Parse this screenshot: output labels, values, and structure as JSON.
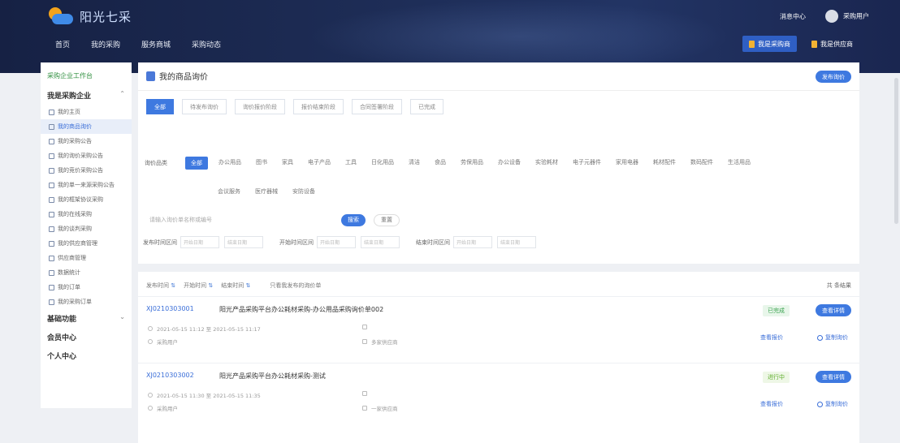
{
  "header": {
    "brand": "阳光七采",
    "nav": [
      "首页",
      "我的采购",
      "服务商城",
      "采购动态"
    ],
    "right": {
      "message": "消息中心",
      "user": "采购用户"
    },
    "buttons": [
      "我是采购商",
      "我是供应商"
    ]
  },
  "sidebar": {
    "workbench": "采购企业工作台",
    "group1": "我是采购企业",
    "items": [
      "我的主页",
      "我的商品询价",
      "我的采购公告",
      "我的询价采购公告",
      "我的竞价采购公告",
      "我的单一来源采购公告",
      "我的框架协议采购",
      "我的在线采购",
      "我的谈判采购",
      "我的供应商管理",
      "供应商管理",
      "数据统计",
      "我的订单",
      "我的采购订单"
    ],
    "group2": "基础功能",
    "group3": "会员中心",
    "group4": "个人中心"
  },
  "main": {
    "title": "我的商品询价",
    "new_button": "发布询价",
    "tabs": [
      "全部",
      "待发布询价",
      "询价报价阶段",
      "报价结束阶段",
      "合同签署阶段",
      "已完成"
    ],
    "filter_label": "询价品类",
    "chips_row1": [
      "全部",
      "办公用品",
      "图书",
      "家具",
      "电子产品",
      "工具",
      "日化用品",
      "清洁",
      "食品",
      "劳保用品",
      "办公设备",
      "实验耗材",
      "电子元器件",
      "家用电器",
      "耗材配件",
      "数码配件",
      "生活用品"
    ],
    "chips_row2": [
      "会议服务",
      "医疗器械",
      "安防设备"
    ],
    "search_placeholder": "请输入询价单名称或编号",
    "search_button": "搜索",
    "reset_button": "重置",
    "ranges": [
      "发布时间区间",
      "开始时间区间",
      "结束时间区间"
    ],
    "range_start": "开始日期",
    "range_end": "结束日期",
    "sort": [
      "发布时间",
      "开始时间",
      "结束时间"
    ],
    "sort_check": "只看我发布的询价单",
    "sort_right": "共 条结果",
    "cards": [
      {
        "code": "XJ0210303001",
        "name": "阳光产品采购平台办公耗材采购-办公用品采购询价单002",
        "status": "已完成",
        "detail": "查看详情",
        "time": "2021-05-15 11:12 至 2021-05-15 11:17",
        "person": "采购用户",
        "mid1": "",
        "mid2": "多家供应商",
        "act1": "查看报价",
        "act2": "复制询价"
      },
      {
        "code": "XJ0210303002",
        "name": "阳光产品采购平台办公耗材采购-测试",
        "status": "进行中",
        "detail": "查看详情",
        "time": "2021-05-15 11:30 至 2021-05-15 11:35",
        "person": "采购用户",
        "mid1": "",
        "mid2": "一家供应商",
        "act1": "查看报价",
        "act2": "复制询价"
      }
    ]
  }
}
